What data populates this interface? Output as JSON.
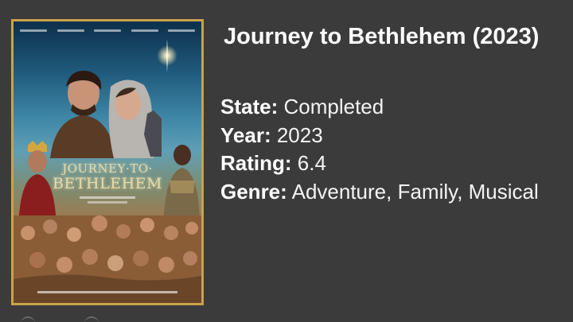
{
  "movie": {
    "title": "Journey to Bethlehem (2023)",
    "poster": {
      "logo_line1": "JOURNEY·TO·",
      "logo_line2": "BETHLEHEM"
    },
    "details": {
      "state_label": "State:",
      "state_value": "Completed",
      "year_label": "Year:",
      "year_value": "2023",
      "rating_label": "Rating:",
      "rating_value": "6.4",
      "genre_label": "Genre:",
      "genre_value": "Adventure, Family, Musical"
    }
  },
  "colors": {
    "background": "#3b3b3b",
    "poster_border": "#c9a24a",
    "text": "#ffffff"
  }
}
